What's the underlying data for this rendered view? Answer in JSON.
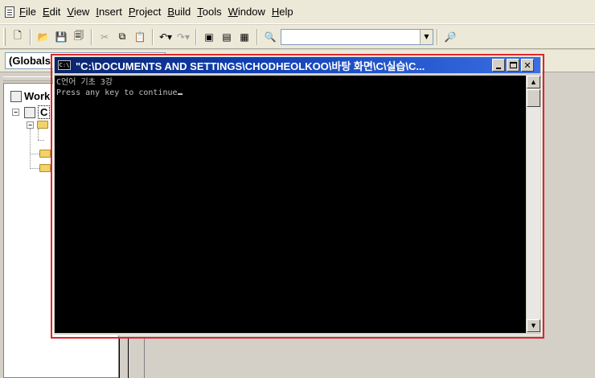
{
  "menubar": {
    "items": [
      "File",
      "Edit",
      "View",
      "Insert",
      "Project",
      "Build",
      "Tools",
      "Window",
      "Help"
    ]
  },
  "toolbar": {
    "find_combo_value": ""
  },
  "wizardbar": {
    "class_combo_value": "(Globals"
  },
  "workspace": {
    "root_label": "Work",
    "project_label": "C"
  },
  "console": {
    "title": "\"C:\\DOCUMENTS AND SETTINGS\\CHODHEOLKOO\\바탕 화면\\C\\실습\\C...",
    "icon_text": "C:\\",
    "lines": [
      "C언어 기초 3강",
      "Press any key to continue"
    ],
    "highlight_color": "#e0242b"
  }
}
